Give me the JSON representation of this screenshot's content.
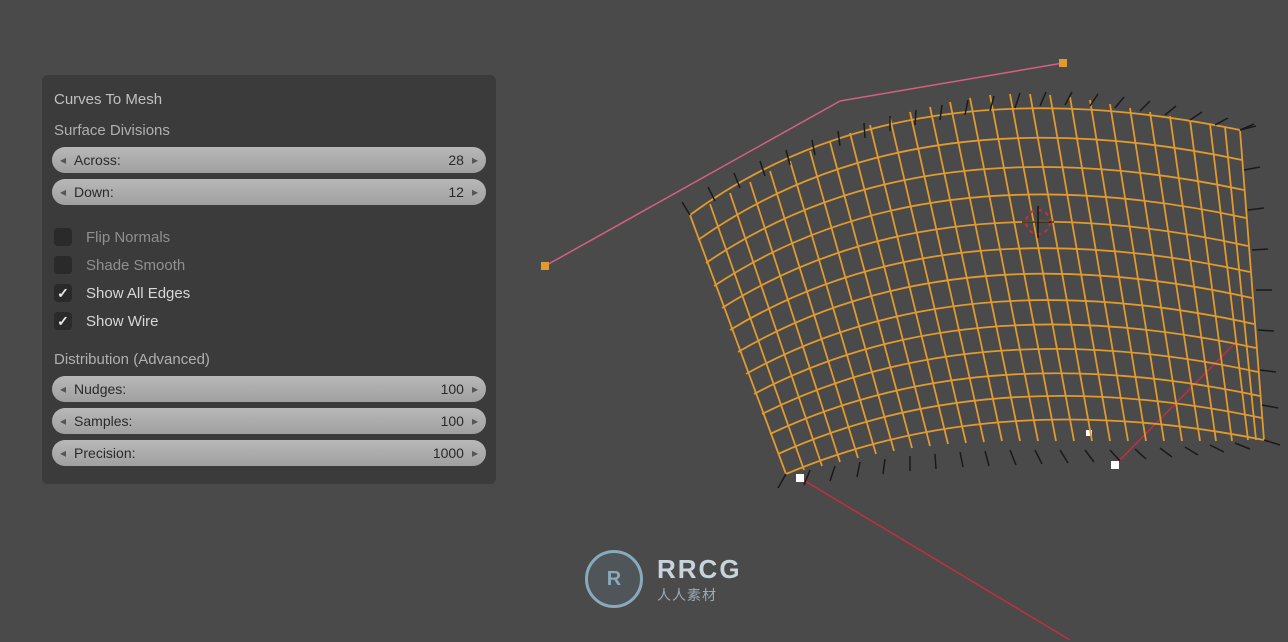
{
  "panel": {
    "title": "Curves To Mesh",
    "surface_divisions_label": "Surface Divisions",
    "across": {
      "label": "Across:",
      "value": "28"
    },
    "down": {
      "label": "Down:",
      "value": "12"
    },
    "flip_normals": {
      "label": "Flip Normals",
      "checked": false
    },
    "shade_smooth": {
      "label": "Shade Smooth",
      "checked": false
    },
    "show_all_edges": {
      "label": "Show All Edges",
      "checked": true
    },
    "show_wire": {
      "label": "Show Wire",
      "checked": true
    },
    "distribution_label": "Distribution (Advanced)",
    "nudges": {
      "label": "Nudges:",
      "value": "100"
    },
    "samples": {
      "label": "Samples:",
      "value": "100"
    },
    "precision": {
      "label": "Precision:",
      "value": "1000"
    }
  },
  "watermark": {
    "logo_text": "R",
    "main": "RRCG",
    "sub": "人人素材"
  }
}
